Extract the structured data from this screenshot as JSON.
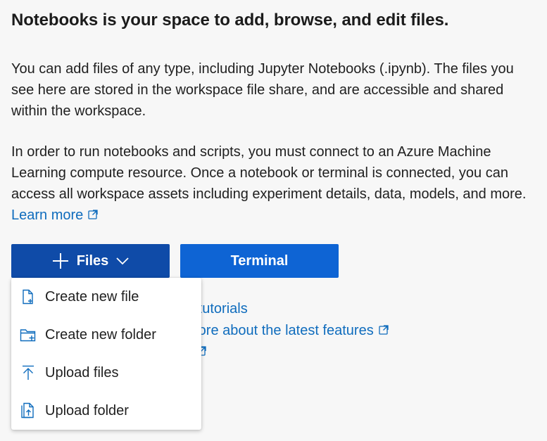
{
  "heading": "Notebooks is your space to add, browse, and edit files.",
  "paragraph1": "You can add files of any type, including Jupyter Notebooks (.ipynb). The files you see here are stored in the workspace file share, and are accessible and shared within the workspace.",
  "paragraph2_text": "In order to run notebooks and scripts, you must connect to an Azure Machine Learning compute resource. Once a notebook or terminal is connected, you can access all workspace assets including experiment details, data, models, and more.",
  "learn_more": "Learn more",
  "buttons": {
    "files": "Files",
    "terminal": "Terminal"
  },
  "partially_hidden_links": {
    "tutorials": "g tutorials",
    "latest_features": "more about the latest features"
  },
  "files_menu": [
    {
      "label": "Create new file",
      "icon": "new-file-icon"
    },
    {
      "label": "Create new folder",
      "icon": "new-folder-icon"
    },
    {
      "label": "Upload files",
      "icon": "upload-icon"
    },
    {
      "label": "Upload folder",
      "icon": "upload-folder-icon"
    }
  ],
  "colors": {
    "link": "#0f6cbd",
    "files_button": "#0f4ba8",
    "terminal_button": "#0e64d4",
    "background": "#f7f7f7"
  }
}
